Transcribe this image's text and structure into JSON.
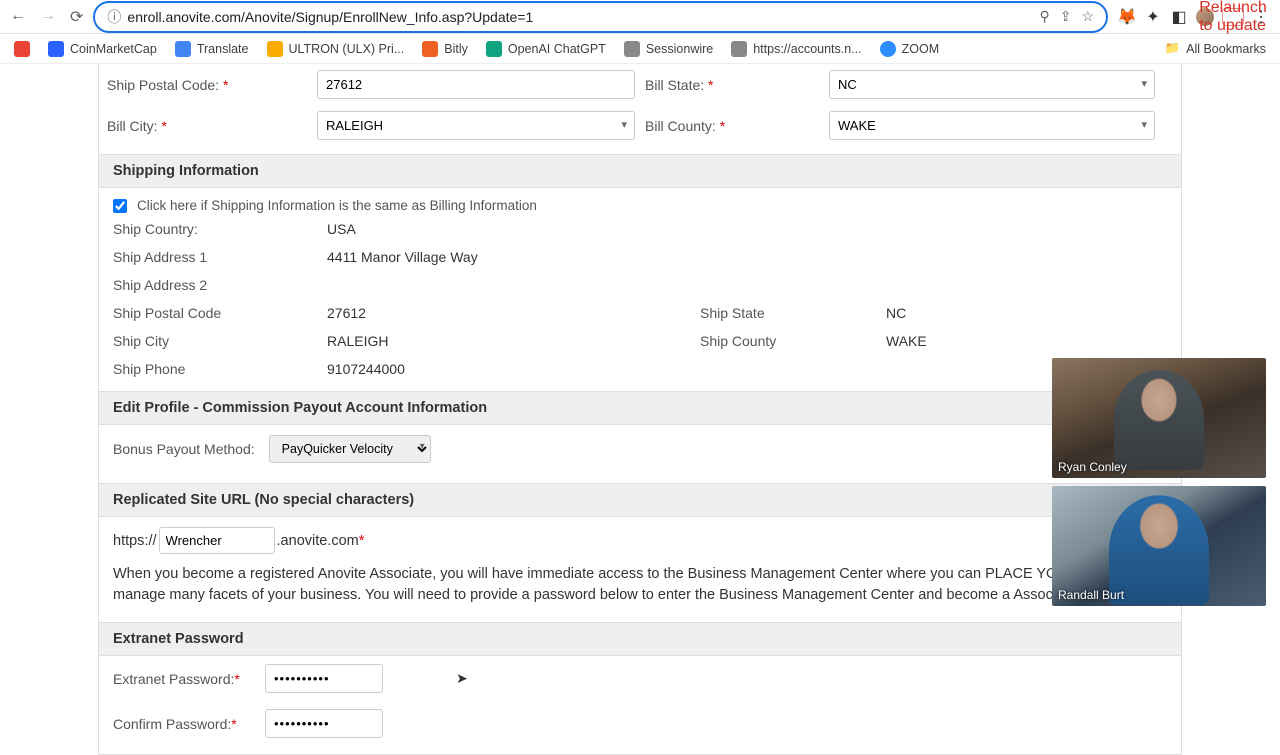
{
  "browser": {
    "url": "enroll.anovite.com/Anovite/Signup/EnrollNew_Info.asp?Update=1",
    "relaunch": "Relaunch to update"
  },
  "bookmarks": {
    "items": [
      {
        "label": "",
        "color": "#ea4335"
      },
      {
        "label": "CoinMarketCap",
        "color": "#2962ff"
      },
      {
        "label": "Translate",
        "color": "#4285f4"
      },
      {
        "label": "ULTRON (ULX) Pri...",
        "color": "#f9ab00"
      },
      {
        "label": "Bitly",
        "color": "#ee6123"
      },
      {
        "label": "OpenAI ChatGPT",
        "color": "#10a37f"
      },
      {
        "label": "Sessionwire",
        "color": "#888"
      },
      {
        "label": "https://accounts.n...",
        "color": "#888"
      },
      {
        "label": "ZOOM",
        "color": "#2d8cff"
      }
    ],
    "all": "All Bookmarks"
  },
  "form": {
    "ship_postal_label": "Ship Postal Code:",
    "ship_postal_value": "27612",
    "bill_state_label": "Bill State:",
    "bill_state_value": "NC",
    "bill_city_label": "Bill City:",
    "bill_city_value": "RALEIGH",
    "bill_county_label": "Bill County:",
    "bill_county_value": "WAKE"
  },
  "shipping": {
    "header": "Shipping Information",
    "same_label": "Click here if Shipping Information is the same as Billing Information",
    "country_label": "Ship Country:",
    "country_value": "USA",
    "addr1_label": "Ship Address 1",
    "addr1_value": "4411 Manor Village Way",
    "addr2_label": "Ship Address 2",
    "addr2_value": "",
    "postal_label": "Ship Postal Code",
    "postal_value": "27612",
    "state_label": "Ship State",
    "state_value": "NC",
    "city_label": "Ship City",
    "city_value": "RALEIGH",
    "county_label": "Ship County",
    "county_value": "WAKE",
    "phone_label": "Ship Phone",
    "phone_value": "9107244000"
  },
  "payout": {
    "header": "Edit Profile - Commission Payout Account Information",
    "label": "Bonus Payout Method:",
    "value": "PayQuicker Velocity"
  },
  "replicated": {
    "header": "Replicated Site URL (No special characters)",
    "prefix": "https://",
    "value": "Wrencher",
    "suffix": ".anovite.com",
    "desc": "When you become a registered Anovite Associate, you will have immediate access to the Business Management Center where you can PLACE YOUR ORDER and manage many facets of your business. You will need to provide a password below to enter the Business Management Center and become a Associate."
  },
  "extranet": {
    "header": "Extranet Password",
    "pw_label": "Extranet Password:",
    "confirm_label": "Confirm Password:",
    "pw_value": "••••••••••",
    "confirm_value": "••••••••••"
  },
  "videos": {
    "name1": "Ryan Conley",
    "name2": "Randall Burt"
  }
}
